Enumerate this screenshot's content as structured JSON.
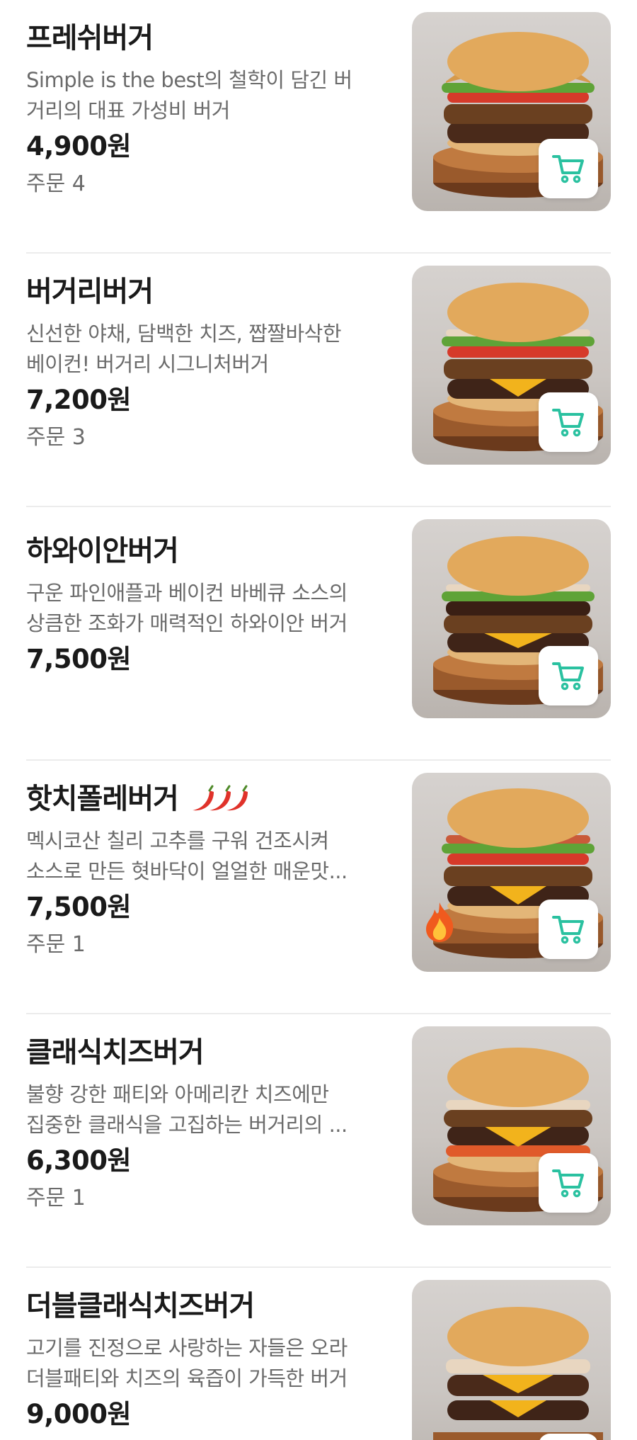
{
  "theme": {
    "accent": "#2ac1a0",
    "text_primary": "#1a1a1a",
    "text_secondary": "#6b6b6b",
    "divider": "#ececec"
  },
  "menu_items": [
    {
      "name": "프레쉬버거",
      "desc_line1": "Simple is the best의 철학이 담긴 버",
      "desc_line2": "거리의 대표 가성비 버거",
      "price": "4,900원",
      "orders": "주문 4",
      "icons": [
        "burger-photo",
        "cart-icon"
      ]
    },
    {
      "name": "버거리버거",
      "desc_line1": "신선한 야채, 담백한 치즈, 짭짤바삭한",
      "desc_line2": "베이컨! 버거리 시그니처버거",
      "price": "7,200원",
      "orders": "주문 3",
      "icons": [
        "burger-photo",
        "cart-icon"
      ]
    },
    {
      "name": "하와이안버거",
      "desc_line1": "구운 파인애플과 베이컨 바베큐 소스의",
      "desc_line2": "상큼한 조화가 매력적인 하와이안 버거",
      "price": "7,500원",
      "orders": "",
      "icons": [
        "burger-photo",
        "cart-icon"
      ]
    },
    {
      "name": "핫치폴레버거",
      "desc_line1": "멕시코산 칠리 고추를 구워 건조시켜",
      "desc_line2": "소스로 만든 혓바닥이 얼얼한 매운맛...",
      "price": "7,500원",
      "orders": "주문 1",
      "icons": [
        "chili-icon",
        "burger-photo",
        "fire-icon",
        "cart-icon"
      ]
    },
    {
      "name": "클래식치즈버거",
      "desc_line1": "불향 강한 패티와 아메리칸 치즈에만",
      "desc_line2": "집중한 클래식을 고집하는 버거리의 ...",
      "price": "6,300원",
      "orders": "주문 1",
      "icons": [
        "burger-photo",
        "cart-icon"
      ]
    },
    {
      "name": "더블클래식치즈버거",
      "desc_line1": "고기를 진정으로 사랑하는 자들은 오라",
      "desc_line2": "더블패티와 치즈의 육즙이 가득한 버거",
      "price": "9,000원",
      "orders": "",
      "icons": [
        "burger-photo",
        "cart-icon"
      ]
    }
  ]
}
